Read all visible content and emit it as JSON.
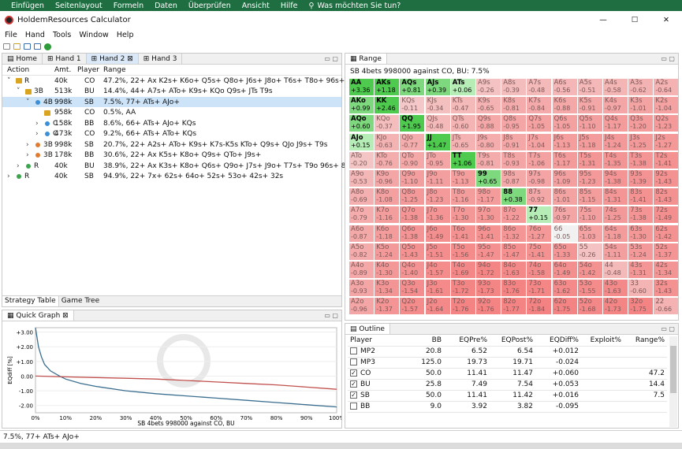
{
  "ribbon": {
    "items": [
      "Einfügen",
      "Seitenlayout",
      "Formeln",
      "Daten",
      "Überprüfen",
      "Ansicht",
      "Hilfe",
      "Was möchten Sie tun?"
    ]
  },
  "window": {
    "title": "HoldemResources Calculator",
    "min": "—",
    "max": "☐",
    "close": "✕"
  },
  "menu": [
    "File",
    "Hand",
    "Tools",
    "Window",
    "Help"
  ],
  "tabs": [
    "Home",
    "Hand 1",
    "Hand 2",
    "Hand 3"
  ],
  "tree": {
    "headers": [
      "Action",
      "Amt.",
      "Player",
      "Range"
    ],
    "rows": [
      {
        "indent": 0,
        "arrow": "˅",
        "dot": "lock",
        "action": "R",
        "amt": "40k",
        "player": "CO",
        "range": "47.2%, 22+ Ax K2s+ K6o+ Q5s+ Q8o+ J6s+ J8o+ T6s+ T8o+ 96s+ 98o 85s+"
      },
      {
        "indent": 1,
        "arrow": "˅",
        "dot": "lock",
        "action": "3B",
        "amt": "513k",
        "player": "BU",
        "range": "14.4%, 44+ A7s+ ATo+ K9s+ KQo Q9s+ JTs T9s"
      },
      {
        "indent": 2,
        "arrow": "˅",
        "dot": "blue",
        "action": "4B",
        "amt": "998k",
        "player": "SB",
        "range": "7.5%, 77+ ATs+ AJo+",
        "sel": true
      },
      {
        "indent": 3,
        "arrow": "",
        "dot": "lock",
        "action": "",
        "amt": "958k",
        "player": "CO",
        "range": "0.5%, AA"
      },
      {
        "indent": 3,
        "arrow": "›",
        "dot": "blue",
        "action": "C",
        "amt": "158k",
        "player": "BB",
        "range": "8.6%, 66+ ATs+ AJo+ KQs"
      },
      {
        "indent": 3,
        "arrow": "›",
        "dot": "blue",
        "action": "C",
        "amt": "473k",
        "player": "CO",
        "range": "9.2%, 66+ ATs+ ATo+ KQs"
      },
      {
        "indent": 2,
        "arrow": "›",
        "dot": "orange",
        "action": "3B",
        "amt": "998k",
        "player": "SB",
        "range": "20.7%, 22+ A2s+ ATo+ K9s+ K7s-K5s KTo+ Q9s+ QJo J9s+ T9s"
      },
      {
        "indent": 2,
        "arrow": "›",
        "dot": "orange",
        "action": "3B",
        "amt": "178k",
        "player": "BB",
        "range": "30.6%, 22+ Ax K5s+ K8o+ Q9s+ QTo+ J9s+"
      },
      {
        "indent": 1,
        "arrow": "›",
        "dot": "green",
        "action": "R",
        "amt": "40k",
        "player": "BU",
        "range": "38.9%, 22+ Ax K3s+ K8o+ Q6s+ Q9o+ J7s+ J9o+ T7s+ T9o 96s+ 86s+ 76s"
      },
      {
        "indent": 0,
        "arrow": "›",
        "dot": "green",
        "action": "R",
        "amt": "40k",
        "player": "SB",
        "range": "94.9%, 22+ 7x+ 62s+ 64o+ 52s+ 53o+ 42s+ 32s"
      }
    ]
  },
  "bottom_tabs": [
    "Strategy Table",
    "Game Tree"
  ],
  "graph": {
    "title": "Quick Graph",
    "ylabel": "EQdiff [%]",
    "xlabel": "SB 4bets 998000 against CO, BU",
    "yticks": [
      "+3.00",
      "+2.00",
      "+1.00",
      "0.00",
      "-1.00",
      "-2.00"
    ],
    "xticks": [
      "0%",
      "10%",
      "20%",
      "30%",
      "40%",
      "50%",
      "60%",
      "70%",
      "80%",
      "90%",
      "100%"
    ]
  },
  "chart_data": {
    "type": "line",
    "title": "",
    "xlabel": "SB 4bets 998000 against CO, BU",
    "ylabel": "EQdiff [%]",
    "xlim": [
      0,
      100
    ],
    "ylim": [
      -2.5,
      3.3
    ],
    "series": [
      {
        "name": "",
        "color": "#3a6e8f",
        "x": [
          0,
          1,
          2,
          3,
          5,
          8,
          10,
          15,
          20,
          30,
          40,
          50,
          60,
          70,
          80,
          90,
          100
        ],
        "y": [
          3.3,
          2.0,
          1.3,
          0.8,
          0.35,
          0.0,
          -0.2,
          -0.5,
          -0.7,
          -1.0,
          -1.2,
          -1.35,
          -1.5,
          -1.65,
          -1.8,
          -1.95,
          -2.1
        ]
      },
      {
        "name": "",
        "color": "#c0504d",
        "x": [
          0,
          10,
          20,
          30,
          40,
          50,
          60,
          70,
          80,
          90,
          100
        ],
        "y": [
          0.0,
          -0.05,
          -0.1,
          -0.15,
          -0.2,
          -0.3,
          -0.4,
          -0.5,
          -0.6,
          -0.75,
          -0.9
        ]
      }
    ]
  },
  "range": {
    "tab": "Range",
    "caption": "SB 4bets 998000 against CO, BU: 7.5%",
    "grid": [
      [
        [
          "AA",
          "+3.36"
        ],
        [
          "AKs",
          "+1.18"
        ],
        [
          "AQs",
          "+0.81"
        ],
        [
          "AJs",
          "+0.39"
        ],
        [
          "ATs",
          "+0.06"
        ],
        [
          "A9s",
          "-0.26"
        ],
        [
          "A8s",
          "-0.39"
        ],
        [
          "A7s",
          "-0.48"
        ],
        [
          "A6s",
          "-0.56"
        ],
        [
          "A5s",
          "-0.51"
        ],
        [
          "A4s",
          "-0.58"
        ],
        [
          "A3s",
          "-0.62"
        ],
        [
          "A2s",
          "-0.64"
        ]
      ],
      [
        [
          "AKo",
          "+0.99"
        ],
        [
          "KK",
          "+2.46"
        ],
        [
          "KQs",
          "-0.11"
        ],
        [
          "KJs",
          "-0.34"
        ],
        [
          "KTs",
          "-0.47"
        ],
        [
          "K9s",
          "-0.65"
        ],
        [
          "K8s",
          "-0.81"
        ],
        [
          "K7s",
          "-0.84"
        ],
        [
          "K6s",
          "-0.88"
        ],
        [
          "K5s",
          "-0.91"
        ],
        [
          "K4s",
          "-0.97"
        ],
        [
          "K3s",
          "-1.01"
        ],
        [
          "K2s",
          "-1.04"
        ]
      ],
      [
        [
          "AQo",
          "+0.60"
        ],
        [
          "KQo",
          "-0.37"
        ],
        [
          "QQ",
          "+1.95"
        ],
        [
          "QJs",
          "-0.48"
        ],
        [
          "QTs",
          "-0.60"
        ],
        [
          "Q9s",
          "-0.88"
        ],
        [
          "Q8s",
          "-0.95"
        ],
        [
          "Q7s",
          "-1.05"
        ],
        [
          "Q6s",
          "-1.05"
        ],
        [
          "Q5s",
          "-1.10"
        ],
        [
          "Q4s",
          "-1.17"
        ],
        [
          "Q3s",
          "-1.20"
        ],
        [
          "Q2s",
          "-1.23"
        ]
      ],
      [
        [
          "AJo",
          "+0.15"
        ],
        [
          "KJo",
          "-0.63"
        ],
        [
          "QJo",
          "-0.77"
        ],
        [
          "JJ",
          "+1.47"
        ],
        [
          "JTs",
          "-0.65"
        ],
        [
          "J9s",
          "-0.80"
        ],
        [
          "J8s",
          "-0.91"
        ],
        [
          "J7s",
          "-1.04"
        ],
        [
          "J6s",
          "-1.13"
        ],
        [
          "J5s",
          "-1.18"
        ],
        [
          "J4s",
          "-1.24"
        ],
        [
          "J3s",
          "-1.25"
        ],
        [
          "J2s",
          "-1.27"
        ]
      ],
      [
        [
          "ATo",
          "-0.20"
        ],
        [
          "KTo",
          "-0.76"
        ],
        [
          "QTo",
          "-0.90"
        ],
        [
          "JTo",
          "-0.95"
        ],
        [
          "TT",
          "+1.06"
        ],
        [
          "T9s",
          "-0.81"
        ],
        [
          "T8s",
          "-0.93"
        ],
        [
          "T7s",
          "-1.06"
        ],
        [
          "T6s",
          "-1.17"
        ],
        [
          "T5s",
          "-1.31"
        ],
        [
          "T4s",
          "-1.35"
        ],
        [
          "T3s",
          "-1.38"
        ],
        [
          "T2s",
          "-1.41"
        ]
      ],
      [
        [
          "A9o",
          "-0.53"
        ],
        [
          "K9o",
          "-0.96"
        ],
        [
          "Q9o",
          "-1.10"
        ],
        [
          "J9o",
          "-1.11"
        ],
        [
          "T9o",
          "-1.13"
        ],
        [
          "99",
          "+0.65"
        ],
        [
          "98s",
          "-0.87"
        ],
        [
          "97s",
          "-0.98"
        ],
        [
          "96s",
          "-1.09"
        ],
        [
          "95s",
          "-1.23"
        ],
        [
          "94s",
          "-1.38"
        ],
        [
          "93s",
          "-1.39"
        ],
        [
          "92s",
          "-1.43"
        ]
      ],
      [
        [
          "A8o",
          "-0.69"
        ],
        [
          "K8o",
          "-1.08"
        ],
        [
          "Q8o",
          "-1.25"
        ],
        [
          "J8o",
          "-1.23"
        ],
        [
          "T8o",
          "-1.16"
        ],
        [
          "98o",
          "-1.17"
        ],
        [
          "88",
          "+0.38"
        ],
        [
          "87s",
          "-0.92"
        ],
        [
          "86s",
          "-1.01"
        ],
        [
          "85s",
          "-1.15"
        ],
        [
          "84s",
          "-1.31"
        ],
        [
          "83s",
          "-1.41"
        ],
        [
          "82s",
          "-1.43"
        ]
      ],
      [
        [
          "A7o",
          "-0.79"
        ],
        [
          "K7o",
          "-1.16"
        ],
        [
          "Q7o",
          "-1.38"
        ],
        [
          "J7o",
          "-1.36"
        ],
        [
          "T7o",
          "-1.30"
        ],
        [
          "97o",
          "-1.30"
        ],
        [
          "87o",
          "-1.22"
        ],
        [
          "77",
          "+0.15"
        ],
        [
          "76s",
          "-0.97"
        ],
        [
          "75s",
          "-1.10"
        ],
        [
          "74s",
          "-1.25"
        ],
        [
          "73s",
          "-1.38"
        ],
        [
          "72s",
          "-1.49"
        ]
      ],
      [
        [
          "A6o",
          "-0.87"
        ],
        [
          "K6o",
          "-1.18"
        ],
        [
          "Q6o",
          "-1.38"
        ],
        [
          "J6o",
          "-1.49"
        ],
        [
          "T6o",
          "-1.41"
        ],
        [
          "96o",
          "-1.41"
        ],
        [
          "86o",
          "-1.32"
        ],
        [
          "76o",
          "-1.27"
        ],
        [
          "66",
          "-0.05"
        ],
        [
          "65s",
          "-1.03"
        ],
        [
          "64s",
          "-1.18"
        ],
        [
          "63s",
          "-1.30"
        ],
        [
          "62s",
          "-1.42"
        ]
      ],
      [
        [
          "A5o",
          "-0.82"
        ],
        [
          "K5o",
          "-1.24"
        ],
        [
          "Q5o",
          "-1.43"
        ],
        [
          "J5o",
          "-1.51"
        ],
        [
          "T5o",
          "-1.56"
        ],
        [
          "95o",
          "-1.47"
        ],
        [
          "85o",
          "-1.47"
        ],
        [
          "75o",
          "-1.41"
        ],
        [
          "65o",
          "-1.33"
        ],
        [
          "55",
          "-0.26"
        ],
        [
          "54s",
          "-1.11"
        ],
        [
          "53s",
          "-1.24"
        ],
        [
          "52s",
          "-1.37"
        ]
      ],
      [
        [
          "A4o",
          "-0.89"
        ],
        [
          "K4o",
          "-1.30"
        ],
        [
          "Q4o",
          "-1.40"
        ],
        [
          "J4o",
          "-1.57"
        ],
        [
          "T4o",
          "-1.69"
        ],
        [
          "94o",
          "-1.72"
        ],
        [
          "84o",
          "-1.63"
        ],
        [
          "74o",
          "-1.58"
        ],
        [
          "64o",
          "-1.49"
        ],
        [
          "54o",
          "-1.42"
        ],
        [
          "44",
          "-0.48"
        ],
        [
          "43s",
          "-1.31"
        ],
        [
          "42s",
          "-1.34"
        ]
      ],
      [
        [
          "A3o",
          "-0.93"
        ],
        [
          "K3o",
          "-1.34"
        ],
        [
          "Q3o",
          "-1.54"
        ],
        [
          "J3o",
          "-1.61"
        ],
        [
          "T3o",
          "-1.72"
        ],
        [
          "93o",
          "-1.73"
        ],
        [
          "83o",
          "-1.76"
        ],
        [
          "73o",
          "-1.71"
        ],
        [
          "63o",
          "-1.62"
        ],
        [
          "53o",
          "-1.55"
        ],
        [
          "43o",
          "-1.63"
        ],
        [
          "33",
          "-0.60"
        ],
        [
          "32s",
          "-1.43"
        ]
      ],
      [
        [
          "A2o",
          "-0.96"
        ],
        [
          "K2o",
          "-1.37"
        ],
        [
          "Q2o",
          "-1.57"
        ],
        [
          "J2o",
          "-1.64"
        ],
        [
          "T2o",
          "-1.76"
        ],
        [
          "92o",
          "-1.76"
        ],
        [
          "82o",
          "-1.77"
        ],
        [
          "72o",
          "-1.84"
        ],
        [
          "62o",
          "-1.75"
        ],
        [
          "52o",
          "-1.68"
        ],
        [
          "42o",
          "-1.73"
        ],
        [
          "32o",
          "-1.75"
        ],
        [
          "22",
          "-0.66"
        ]
      ]
    ]
  },
  "outline": {
    "tab": "Outline",
    "headers": [
      "Player",
      "BB",
      "EQPre%",
      "EQPost%",
      "EQDiff%",
      "Exploit%",
      "Range%"
    ],
    "rows": [
      {
        "checked": false,
        "player": "MP2",
        "bb": "20.8",
        "pre": "6.52",
        "post": "6.54",
        "diff": "+0.012",
        "exploit": "",
        "range": ""
      },
      {
        "checked": false,
        "player": "MP3",
        "bb": "125.0",
        "pre": "19.73",
        "post": "19.71",
        "diff": "-0.024",
        "exploit": "",
        "range": ""
      },
      {
        "checked": true,
        "player": "CO",
        "bb": "50.0",
        "pre": "11.41",
        "post": "11.47",
        "diff": "+0.060",
        "exploit": "",
        "range": "47.2"
      },
      {
        "checked": true,
        "player": "BU",
        "bb": "25.8",
        "pre": "7.49",
        "post": "7.54",
        "diff": "+0.053",
        "exploit": "",
        "range": "14.4"
      },
      {
        "checked": true,
        "player": "SB",
        "bb": "50.0",
        "pre": "11.41",
        "post": "11.42",
        "diff": "+0.016",
        "exploit": "",
        "range": "7.5"
      },
      {
        "checked": false,
        "player": "BB",
        "bb": "9.0",
        "pre": "3.92",
        "post": "3.82",
        "diff": "-0.095",
        "exploit": "",
        "range": ""
      }
    ]
  },
  "status": "7.5%, 77+ ATs+ AJo+",
  "colors": {
    "ribbon": "#1e6e42",
    "selected": "#cde3f8",
    "green_strong": "#4ecb4e",
    "green_light": "#a9e9a9",
    "red": "#f39a9a"
  }
}
